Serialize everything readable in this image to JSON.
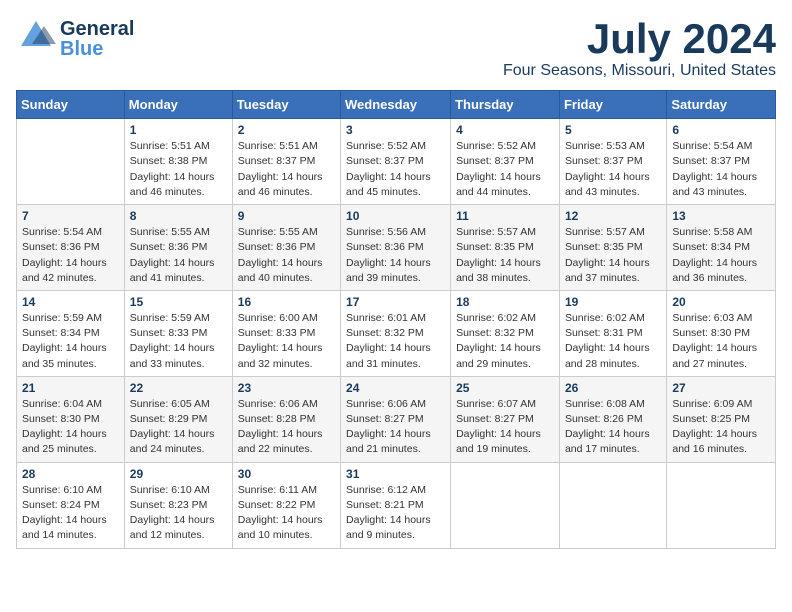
{
  "header": {
    "logo_general": "General",
    "logo_blue": "Blue",
    "title": "July 2024",
    "location": "Four Seasons, Missouri, United States"
  },
  "calendar": {
    "days_of_week": [
      "Sunday",
      "Monday",
      "Tuesday",
      "Wednesday",
      "Thursday",
      "Friday",
      "Saturday"
    ],
    "weeks": [
      [
        {
          "day": "",
          "lines": []
        },
        {
          "day": "1",
          "lines": [
            "Sunrise: 5:51 AM",
            "Sunset: 8:38 PM",
            "Daylight: 14 hours",
            "and 46 minutes."
          ]
        },
        {
          "day": "2",
          "lines": [
            "Sunrise: 5:51 AM",
            "Sunset: 8:37 PM",
            "Daylight: 14 hours",
            "and 46 minutes."
          ]
        },
        {
          "day": "3",
          "lines": [
            "Sunrise: 5:52 AM",
            "Sunset: 8:37 PM",
            "Daylight: 14 hours",
            "and 45 minutes."
          ]
        },
        {
          "day": "4",
          "lines": [
            "Sunrise: 5:52 AM",
            "Sunset: 8:37 PM",
            "Daylight: 14 hours",
            "and 44 minutes."
          ]
        },
        {
          "day": "5",
          "lines": [
            "Sunrise: 5:53 AM",
            "Sunset: 8:37 PM",
            "Daylight: 14 hours",
            "and 43 minutes."
          ]
        },
        {
          "day": "6",
          "lines": [
            "Sunrise: 5:54 AM",
            "Sunset: 8:37 PM",
            "Daylight: 14 hours",
            "and 43 minutes."
          ]
        }
      ],
      [
        {
          "day": "7",
          "lines": [
            "Sunrise: 5:54 AM",
            "Sunset: 8:36 PM",
            "Daylight: 14 hours",
            "and 42 minutes."
          ]
        },
        {
          "day": "8",
          "lines": [
            "Sunrise: 5:55 AM",
            "Sunset: 8:36 PM",
            "Daylight: 14 hours",
            "and 41 minutes."
          ]
        },
        {
          "day": "9",
          "lines": [
            "Sunrise: 5:55 AM",
            "Sunset: 8:36 PM",
            "Daylight: 14 hours",
            "and 40 minutes."
          ]
        },
        {
          "day": "10",
          "lines": [
            "Sunrise: 5:56 AM",
            "Sunset: 8:36 PM",
            "Daylight: 14 hours",
            "and 39 minutes."
          ]
        },
        {
          "day": "11",
          "lines": [
            "Sunrise: 5:57 AM",
            "Sunset: 8:35 PM",
            "Daylight: 14 hours",
            "and 38 minutes."
          ]
        },
        {
          "day": "12",
          "lines": [
            "Sunrise: 5:57 AM",
            "Sunset: 8:35 PM",
            "Daylight: 14 hours",
            "and 37 minutes."
          ]
        },
        {
          "day": "13",
          "lines": [
            "Sunrise: 5:58 AM",
            "Sunset: 8:34 PM",
            "Daylight: 14 hours",
            "and 36 minutes."
          ]
        }
      ],
      [
        {
          "day": "14",
          "lines": [
            "Sunrise: 5:59 AM",
            "Sunset: 8:34 PM",
            "Daylight: 14 hours",
            "and 35 minutes."
          ]
        },
        {
          "day": "15",
          "lines": [
            "Sunrise: 5:59 AM",
            "Sunset: 8:33 PM",
            "Daylight: 14 hours",
            "and 33 minutes."
          ]
        },
        {
          "day": "16",
          "lines": [
            "Sunrise: 6:00 AM",
            "Sunset: 8:33 PM",
            "Daylight: 14 hours",
            "and 32 minutes."
          ]
        },
        {
          "day": "17",
          "lines": [
            "Sunrise: 6:01 AM",
            "Sunset: 8:32 PM",
            "Daylight: 14 hours",
            "and 31 minutes."
          ]
        },
        {
          "day": "18",
          "lines": [
            "Sunrise: 6:02 AM",
            "Sunset: 8:32 PM",
            "Daylight: 14 hours",
            "and 29 minutes."
          ]
        },
        {
          "day": "19",
          "lines": [
            "Sunrise: 6:02 AM",
            "Sunset: 8:31 PM",
            "Daylight: 14 hours",
            "and 28 minutes."
          ]
        },
        {
          "day": "20",
          "lines": [
            "Sunrise: 6:03 AM",
            "Sunset: 8:30 PM",
            "Daylight: 14 hours",
            "and 27 minutes."
          ]
        }
      ],
      [
        {
          "day": "21",
          "lines": [
            "Sunrise: 6:04 AM",
            "Sunset: 8:30 PM",
            "Daylight: 14 hours",
            "and 25 minutes."
          ]
        },
        {
          "day": "22",
          "lines": [
            "Sunrise: 6:05 AM",
            "Sunset: 8:29 PM",
            "Daylight: 14 hours",
            "and 24 minutes."
          ]
        },
        {
          "day": "23",
          "lines": [
            "Sunrise: 6:06 AM",
            "Sunset: 8:28 PM",
            "Daylight: 14 hours",
            "and 22 minutes."
          ]
        },
        {
          "day": "24",
          "lines": [
            "Sunrise: 6:06 AM",
            "Sunset: 8:27 PM",
            "Daylight: 14 hours",
            "and 21 minutes."
          ]
        },
        {
          "day": "25",
          "lines": [
            "Sunrise: 6:07 AM",
            "Sunset: 8:27 PM",
            "Daylight: 14 hours",
            "and 19 minutes."
          ]
        },
        {
          "day": "26",
          "lines": [
            "Sunrise: 6:08 AM",
            "Sunset: 8:26 PM",
            "Daylight: 14 hours",
            "and 17 minutes."
          ]
        },
        {
          "day": "27",
          "lines": [
            "Sunrise: 6:09 AM",
            "Sunset: 8:25 PM",
            "Daylight: 14 hours",
            "and 16 minutes."
          ]
        }
      ],
      [
        {
          "day": "28",
          "lines": [
            "Sunrise: 6:10 AM",
            "Sunset: 8:24 PM",
            "Daylight: 14 hours",
            "and 14 minutes."
          ]
        },
        {
          "day": "29",
          "lines": [
            "Sunrise: 6:10 AM",
            "Sunset: 8:23 PM",
            "Daylight: 14 hours",
            "and 12 minutes."
          ]
        },
        {
          "day": "30",
          "lines": [
            "Sunrise: 6:11 AM",
            "Sunset: 8:22 PM",
            "Daylight: 14 hours",
            "and 10 minutes."
          ]
        },
        {
          "day": "31",
          "lines": [
            "Sunrise: 6:12 AM",
            "Sunset: 8:21 PM",
            "Daylight: 14 hours",
            "and 9 minutes."
          ]
        },
        {
          "day": "",
          "lines": []
        },
        {
          "day": "",
          "lines": []
        },
        {
          "day": "",
          "lines": []
        }
      ]
    ]
  }
}
